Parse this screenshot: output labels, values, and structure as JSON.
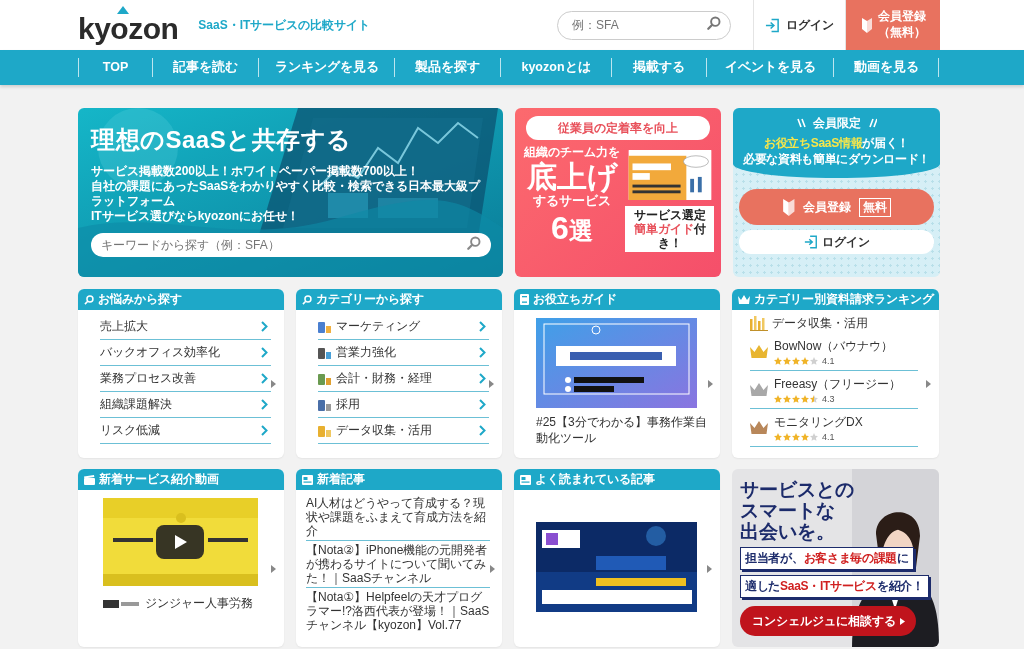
{
  "header": {
    "logo": "kyozon",
    "tagline": "SaaS・ITサービスの比較サイト",
    "search_placeholder": "例：SFA",
    "login": "ログイン",
    "register": [
      "会員登録",
      "（無料）"
    ]
  },
  "nav": [
    {
      "label": "TOP"
    },
    {
      "label": "記事を読む"
    },
    {
      "label": "ランキングを見る"
    },
    {
      "label": "製品を探す"
    },
    {
      "label": "kyozonとは"
    },
    {
      "label": "掲載する"
    },
    {
      "label": "イベントを見る"
    },
    {
      "label": "動画を見る"
    }
  ],
  "hero": {
    "title": "理想のSaaSと共存する",
    "lines": [
      "サービス掲載数200以上！ホワイトペーパー掲載数700以上！",
      "自社の課題にあったSaaSをわかりやすく比較・検索できる日本最大級プラットフォーム",
      "ITサービス選びならkyozonにお任せ！"
    ],
    "search_placeholder": "キーワードから探す（例：SFA）"
  },
  "promo": {
    "badge": "従業員の定着率を向上",
    "subtitle": "組織のチーム力を",
    "headline": "底上げ",
    "tail": "するサービス",
    "count": "6",
    "count_unit": "選",
    "callout": {
      "line1": "サービス選定",
      "highlight": "簡単ガイド",
      "rest": "付き！"
    }
  },
  "member": {
    "heading": "会員限定",
    "highlight": "お役立ちSaaS情報",
    "rest": "が届く！",
    "line2": "必要な資料も簡単にダウンロード！",
    "register": "会員登録",
    "free": "無料",
    "login": "ログイン"
  },
  "cards": [
    {
      "kind": "list",
      "title": "お悩みから探す",
      "items": [
        "売上拡大",
        "バックオフィス効率化",
        "業務プロセス改善",
        "組織課題解決",
        "リスク低減"
      ]
    },
    {
      "kind": "category",
      "title": "カテゴリーから探す",
      "items": [
        "マーケティング",
        "営業力強化",
        "会計・財務・経理",
        "採用",
        "データ収集・活用"
      ]
    },
    {
      "kind": "guide",
      "title": "お役立ちガイド",
      "caption": "#25【3分でわかる】事務作業自動化ツール"
    },
    {
      "kind": "ranking",
      "title": "カテゴリー別資料請求ランキング",
      "category": "データ収集・活用",
      "entries": [
        {
          "name": "BowNow（バウナウ）",
          "stars": 4,
          "rating": "4.1",
          "color": "#e8b530"
        },
        {
          "name": "Freeasy（フリージー）",
          "stars": 4.5,
          "rating": "4.3",
          "color": "#a8a8a8"
        },
        {
          "name": "モニタリングDX",
          "stars": 4,
          "rating": "4.1",
          "color": "#b8875a"
        }
      ]
    },
    {
      "kind": "video",
      "title": "新着サービス紹介動画",
      "caption": "ジンジャー人事労務"
    },
    {
      "kind": "articles",
      "title": "新着記事",
      "items": [
        "AI人材はどうやって育成する？現状や課題をふまえて育成方法を紹介",
        "【Nota②】iPhone機能の元開発者が携わるサイトについて聞いてみた！｜SaaSチャンネル",
        "【Nota①】Helpfeelの天才プログラマー!?洛西代表が登場！｜SaaSチャンネル【kyozon】Vol.77"
      ]
    },
    {
      "kind": "popular",
      "title": "よく読まれている記事"
    },
    {
      "kind": "ad",
      "headline": [
        "サービスとの",
        "スマートな",
        "出会いを。"
      ],
      "lines": [
        [
          {
            "text": "担当者が、",
            "highlight": false
          },
          {
            "text": "お客さま毎の課題",
            "highlight": true
          },
          {
            "text": "に",
            "highlight": false
          }
        ],
        [
          {
            "text": "適した",
            "highlight": false
          },
          {
            "text": "SaaS・ITサービス",
            "highlight": true
          },
          {
            "text": "を紹介！",
            "highlight": false
          }
        ]
      ],
      "button": "コンシェルジュに相談する"
    }
  ]
}
